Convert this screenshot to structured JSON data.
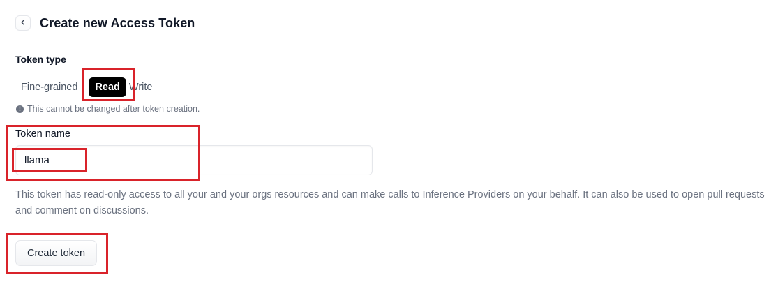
{
  "header": {
    "back_icon": "chevron-left-icon",
    "title": "Create new Access Token"
  },
  "token_type": {
    "label": "Token type",
    "options": [
      "Fine-grained",
      "Read",
      "Write"
    ],
    "selected": "Read",
    "note": "This cannot be changed after token creation.",
    "note_icon": "info-icon",
    "active_bg": "#000000",
    "active_fg": "#ffffff"
  },
  "token_name": {
    "label": "Token name",
    "value": "llama"
  },
  "description": "This token has read-only access to all your and your orgs resources and can make calls to Inference Providers on your behalf. It can also be used to open pull requests and comment on discussions.",
  "actions": {
    "create_label": "Create token"
  },
  "annotation_color": "#d9232a"
}
